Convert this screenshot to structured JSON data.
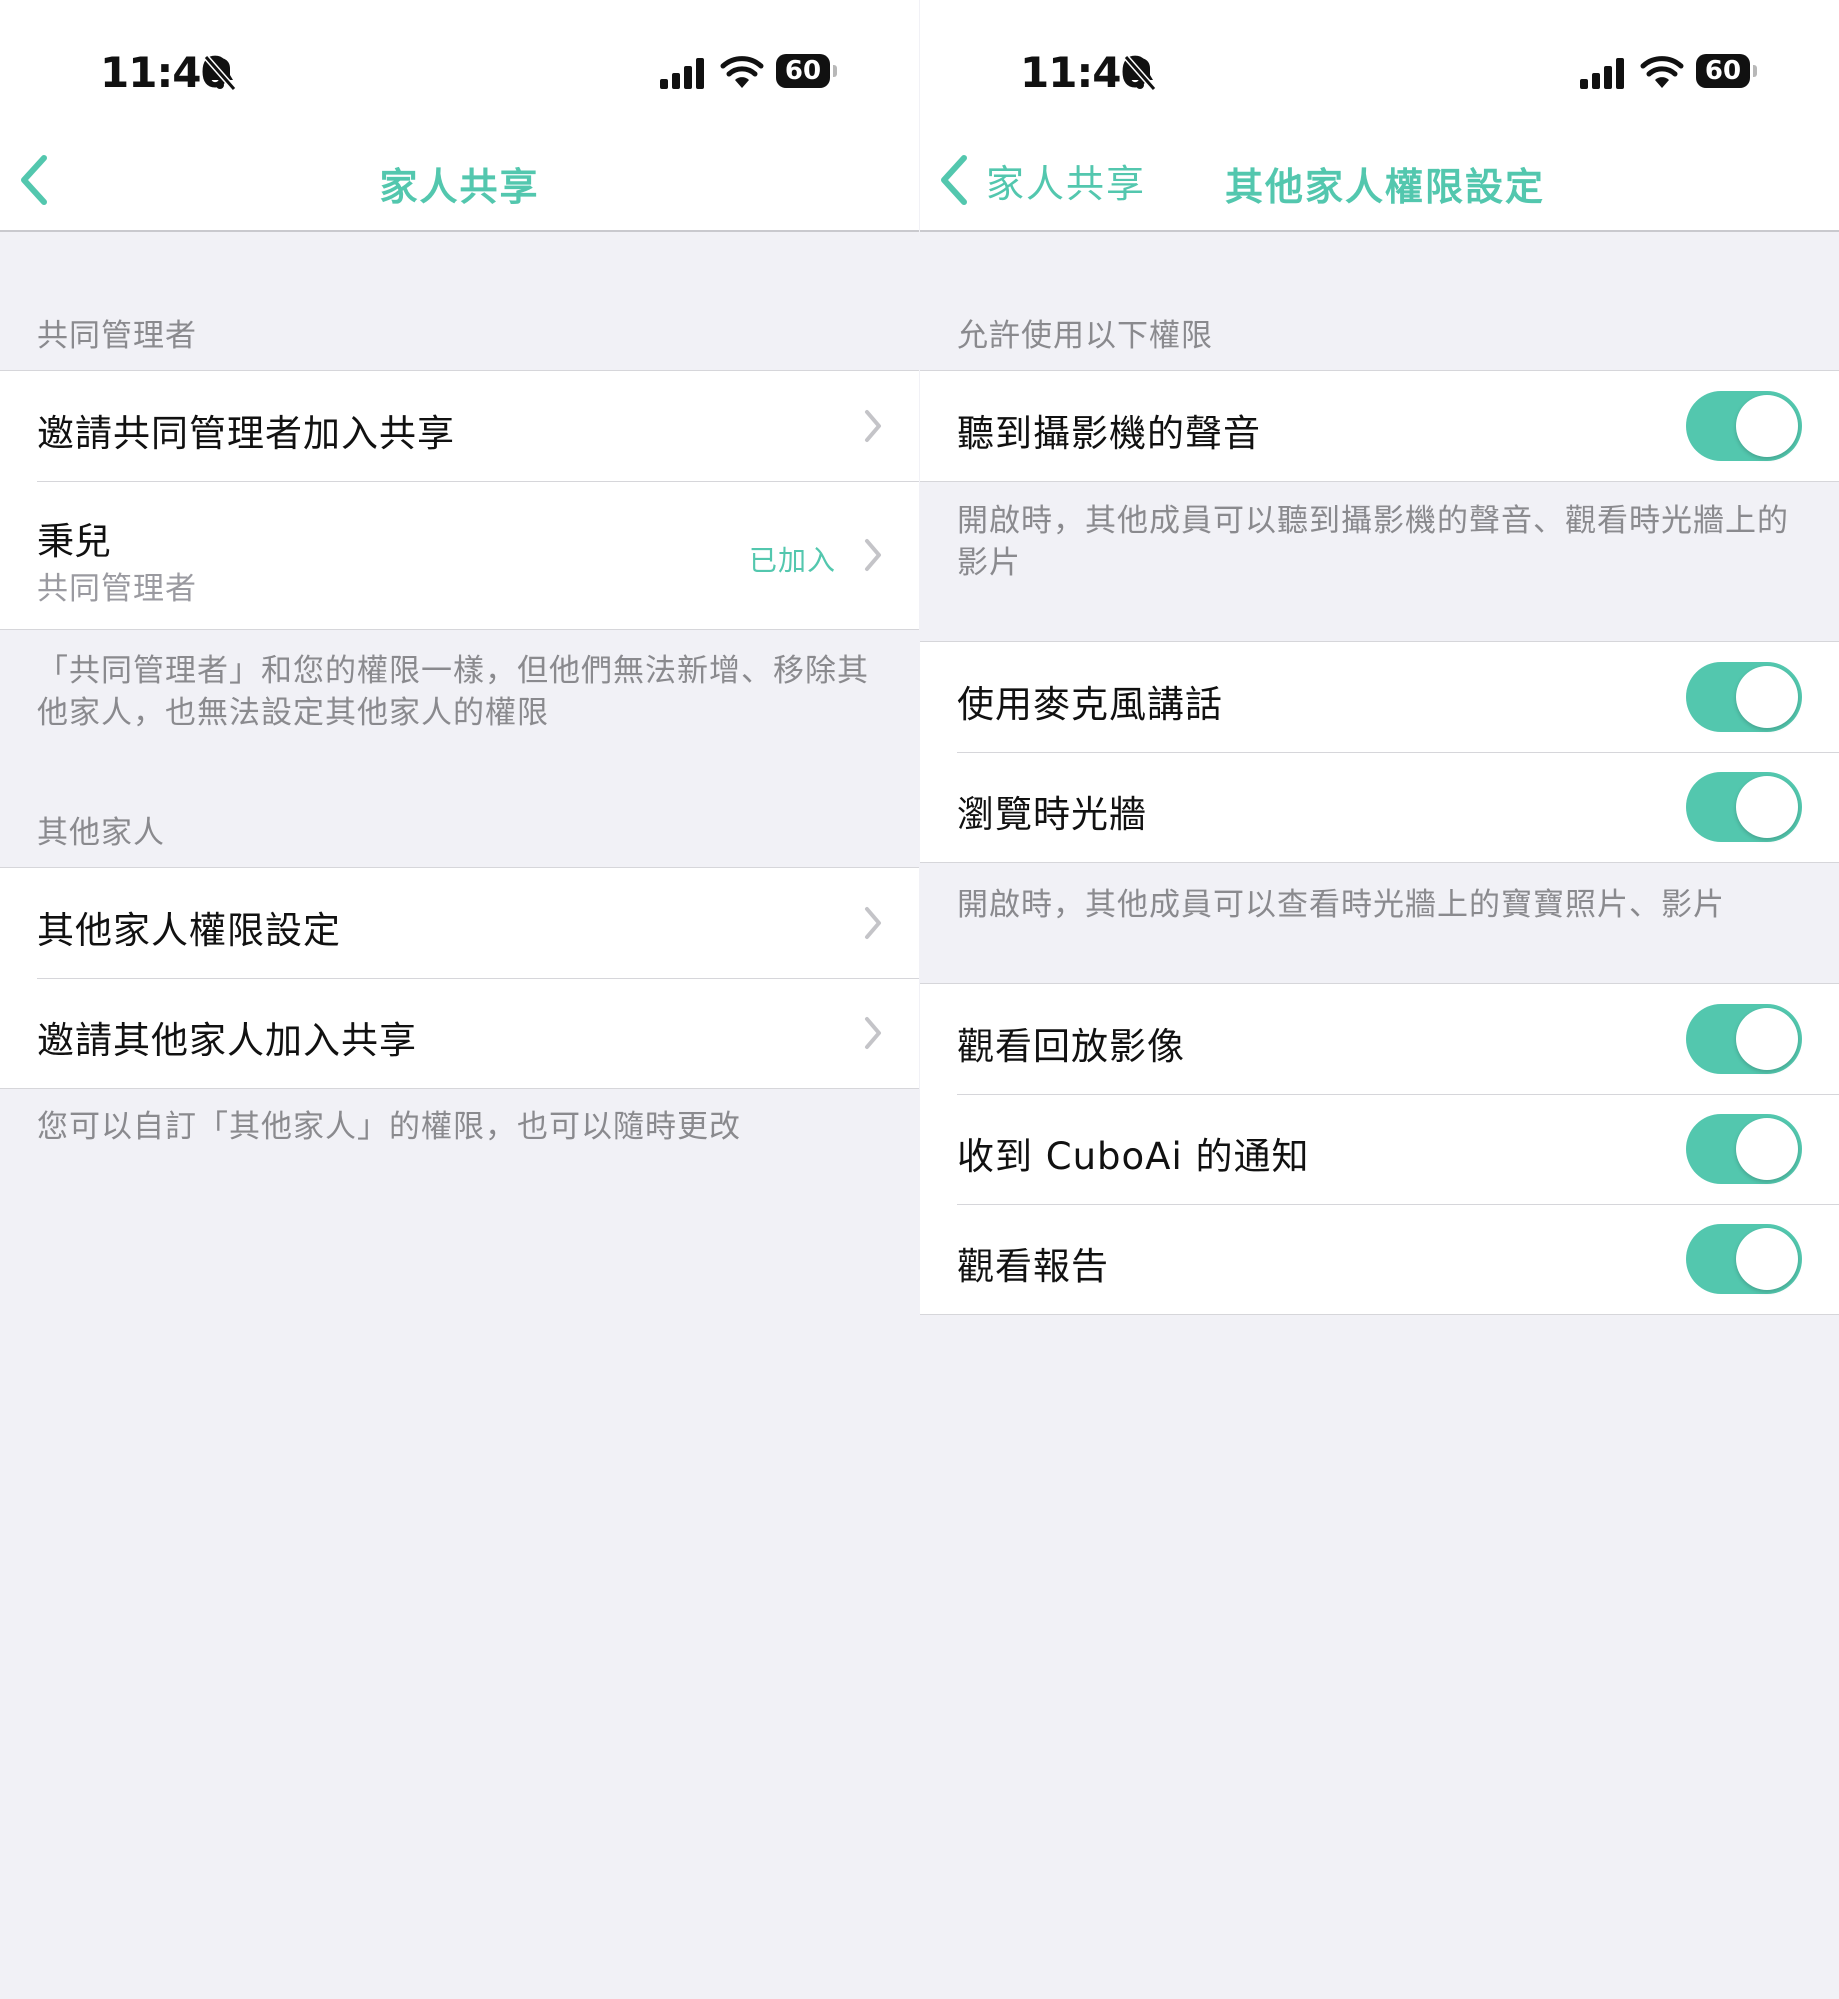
{
  "status": {
    "time": "11:40",
    "battery": "60"
  },
  "left": {
    "nav": {
      "title": "家人共享"
    },
    "co_admin_header": "共同管理者",
    "invite_co_admin": "邀請共同管理者加入共享",
    "member": {
      "name": "秉兒",
      "role": "共同管理者",
      "status": "已加入"
    },
    "co_admin_footer": "「共同管理者」和您的權限一樣，但他們無法新增、移除其他家人，也無法設定其他家人的權限",
    "others_header": "其他家人",
    "others_permission": "其他家人權限設定",
    "invite_others": "邀請其他家人加入共享",
    "others_footer": "您可以自訂「其他家人」的權限，也可以隨時更改"
  },
  "right": {
    "nav": {
      "back_label": "家人共享",
      "title": "其他家人權限設定"
    },
    "section_header": "允許使用以下權限",
    "toggles": [
      {
        "label": "聽到攝影機的聲音",
        "on": true
      },
      {
        "label": "使用麥克風講話",
        "on": true
      },
      {
        "label": "瀏覽時光牆",
        "on": true
      },
      {
        "label": "觀看回放影像",
        "on": true
      },
      {
        "label": "收到 CuboAi 的通知",
        "on": true
      },
      {
        "label": "觀看報告",
        "on": true
      }
    ],
    "footer_sound": "開啟時，其他成員可以聽到攝影機的聲音、觀看時光牆上的影片",
    "footer_timeline": "開啟時，其他成員可以查看時光牆上的寶寶照片、影片"
  },
  "colors": {
    "accent": "#53c7ae",
    "background": "#f1f1f6"
  }
}
